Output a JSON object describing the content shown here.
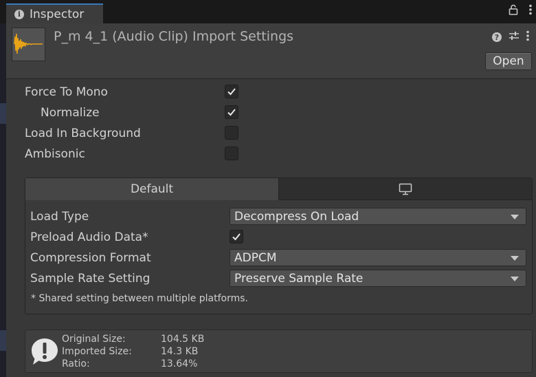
{
  "window": {
    "tab_title": "Inspector",
    "tab_icon": "info-icon",
    "tab_tools": [
      "lock-icon",
      "kebab-menu-icon"
    ]
  },
  "header": {
    "title": "P_m 4_1 (Audio Clip) Import Settings",
    "thumbnail_icon": "audio-waveform-icon",
    "icons": [
      "help-icon",
      "preset-sliders-icon",
      "kebab-menu-icon"
    ],
    "open_button": "Open"
  },
  "settings": {
    "force_to_mono": {
      "label": "Force To Mono",
      "checked": true
    },
    "normalize": {
      "label": "Normalize",
      "checked": true
    },
    "load_in_background": {
      "label": "Load In Background",
      "checked": false
    },
    "ambisonic": {
      "label": "Ambisonic",
      "checked": false
    }
  },
  "platforms": {
    "tabs": [
      {
        "label": "Default",
        "selected": true
      },
      {
        "icon": "monitor-icon",
        "selected": false
      }
    ],
    "load_type": {
      "label": "Load Type",
      "value": "Decompress On Load"
    },
    "preload": {
      "label": "Preload Audio Data*",
      "checked": true
    },
    "compression_format": {
      "label": "Compression Format",
      "value": "ADPCM"
    },
    "sample_rate": {
      "label": "Sample Rate Setting",
      "value": "Preserve Sample Rate"
    },
    "note": "* Shared setting between multiple platforms."
  },
  "info": {
    "icon": "info-exclamation-icon",
    "original_size": {
      "label": "Original Size:",
      "value": "104.5 KB"
    },
    "imported_size": {
      "label": "Imported Size:",
      "value": "14.3 KB"
    },
    "ratio": {
      "label": "Ratio:",
      "value": "13.64%"
    }
  },
  "colors": {
    "accent_tab": "#3a79bb",
    "waveform": "#e8a317"
  }
}
